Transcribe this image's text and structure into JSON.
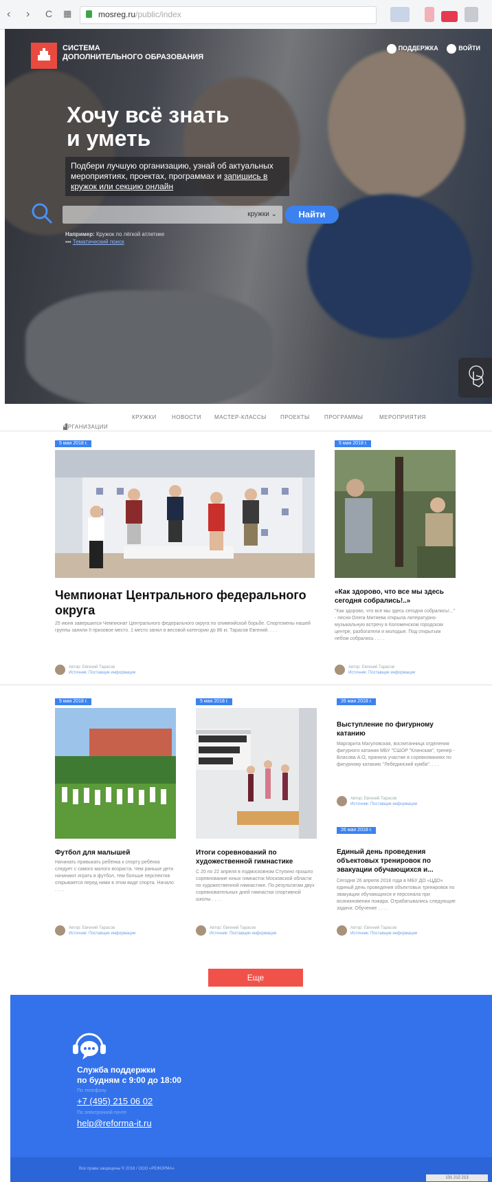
{
  "browser": {
    "back": "‹",
    "forward": "›",
    "reload": "C",
    "apps": "▦",
    "url_domain": "mosreg.ru",
    "url_path": "/public/index"
  },
  "header": {
    "logo_line1": "СИСТЕМА",
    "logo_line2": "ДОПОЛНИТЕЛЬНОГО ОБРАЗОВАНИЯ",
    "support_link": "ПОДДЕРЖКА",
    "login_link": "ВОЙТИ"
  },
  "hero": {
    "headline_line1": "Хочу всё знать",
    "headline_line2": "и уметь",
    "lead_text": "Подбери лучшую организацию, узнай об актуальных мероприятиях, проектах, программах и",
    "lead_link": "запишись в кружок или секцию онлайн",
    "search_placeholder": "",
    "search_select": "кружки",
    "search_button": "Найти",
    "example_label": "Например:",
    "example_text": "Кружок по лёгкой атлетике",
    "example2_text": "Тематический поиск"
  },
  "nav": {
    "items": [
      "ОРГАНИЗАЦИИ",
      "КРУЖКИ",
      "НОВОСТИ",
      "МАСТЕР-КЛАССЫ",
      "ПРОЕКТЫ",
      "ПРОГРАММЫ",
      "МЕРОПРИЯТИЯ"
    ]
  },
  "news": [
    {
      "date": "5 мая 2018 г.",
      "title": "Чемпионат Центрального федерального округа",
      "text": "25 июня завершился Чемпионат Центрального федерального округа по олимпийской борьбе. Спортсмены нашей группы заняли II призовое место. 1 место занял в весовой категории до 86 кг, Тарасов Евгений. . . .",
      "author": "Автор: Евгений Тарасов",
      "source": "Источник: Поставщик информации"
    },
    {
      "date": "5 мая 2018 г.",
      "title": "«Как здорово, что все мы здесь сегодня собрались!..»",
      "text": "\"Как здорово, что все мы здесь сегодня собрались!...\" - песня Олега Митяева открыла литературно-музыкальную встречу в Коломенском городском центре, разбогатели и молодые. Под открытым небом собрались . . . .",
      "author": "Автор: Евгений Тарасов",
      "source": "Источник: Поставщик информации"
    },
    {
      "date": "5 мая 2018 г.",
      "title": "Футбол для малышей",
      "text": "Начинать привыкать ребёнка к спорту ребёнка следует с самого малого возраста. Чем раньше дети начинают играть в футбол, тем больше перспектив открывается перед ними в этом виде спорта. Начало . . . .",
      "author": "Автор: Евгений Тарасов",
      "source": "Источник: Поставщик информации"
    },
    {
      "date": "5 мая 2018 г.",
      "title": "Итоги соревнований по художественной гимнастике",
      "text": "С 20 по 22 апреля в подмосковном Ступино прошло соревнование юных гимнасток Московской области по художественной гимнастике. По результатам двух соревновательных дней гимнастки спортивной школы . . . .",
      "author": "Автор: Евгений Тарасов",
      "source": "Источник: Поставщик информации"
    },
    {
      "date": "26 мая 2018 г.",
      "title": "Выступление по фигурному катанию",
      "text": "Маргарита Магуловская, воспитанница отделения фигурного катания МБУ \"СШОР \"Клинская\", тренер - Власова А.О, приняла участие в соревнованиях по фигурному катанию \"Лебединский кумби\". . . .",
      "author": "Автор: Евгений Тарасов",
      "source": "Источник: Поставщик информации"
    },
    {
      "date": "26 мая 2018 г.",
      "title": "Единый день проведения объектовых тренировок по эвакуации обучающихся и...",
      "text": "Сегодня 26 апреля 2018 года в МБУ ДО «ЦДО» единый день проведения объектовых тренировок по эвакуации обучающихся и персонала при возникновении пожара. Отрабатывались следующие задачи: Обучение . . . .",
      "author": "Автор: Евгений Тарасов",
      "source": "Источник: Поставщик информации"
    }
  ],
  "more_button": "Еще",
  "footer": {
    "support_line1": "Служба поддержки",
    "support_line2": "по будням с 9:00 до 18:00",
    "phone_label": "По телефону",
    "phone": "+7 (495) 215 06 02",
    "email_label": "По электронной почте",
    "email": "help@reforma-it.ru",
    "copyright": "Все права защищены © 2018 / ООО «РЕФОРМА»",
    "counter": "131 212 213"
  }
}
